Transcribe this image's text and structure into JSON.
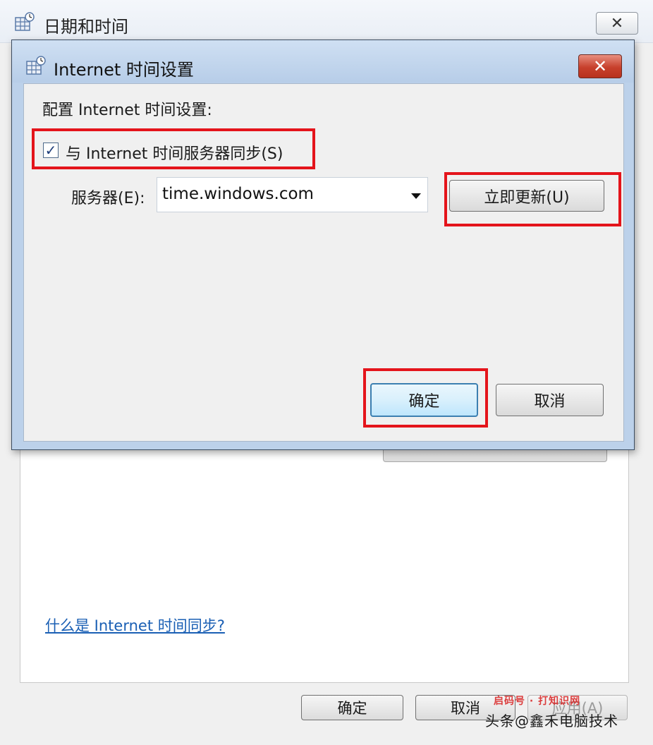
{
  "outer_window": {
    "title": "日期和时间",
    "close_glyph": "✕",
    "help_link": "什么是 Internet 时间同步?",
    "buttons": {
      "ok": "确定",
      "cancel": "取消",
      "apply": "应用(A)"
    },
    "watermark": {
      "part1": "头条@鑫禾电脑技术",
      "part2": "启码号 · 打知识网"
    }
  },
  "dialog": {
    "title": "Internet 时间设置",
    "close_glyph": "✕",
    "config_label": "配置 Internet 时间设置:",
    "sync_checkbox": {
      "label": "与 Internet 时间服务器同步(S)",
      "checked": true,
      "check_glyph": "✓"
    },
    "server": {
      "label": "服务器(E):",
      "value": "time.windows.com"
    },
    "update_now_button": "立即更新(U)",
    "ok_button": "确定",
    "cancel_button": "取消"
  },
  "colors": {
    "highlight_box": "#e4141b",
    "link": "#1a5fb4",
    "dialog_frame": "#bcd1ea",
    "close_button": "#c7402c"
  },
  "icons": {
    "window_icon": "calendar-clock-icon",
    "dialog_icon": "calendar-clock-icon",
    "dropdown": "chevron-down-icon"
  }
}
